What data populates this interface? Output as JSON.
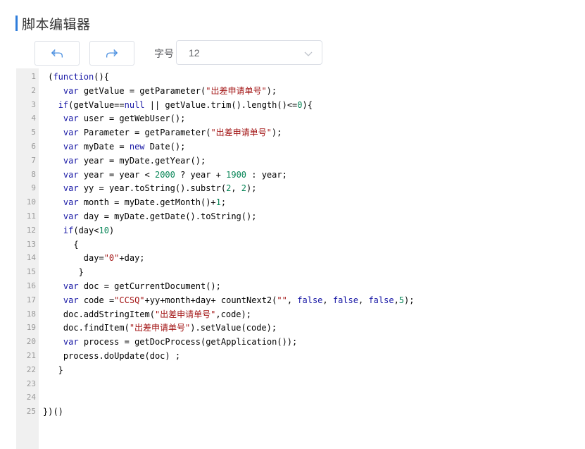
{
  "header": {
    "title": "脚本编辑器"
  },
  "toolbar": {
    "undo_icon": "undo-arrow-icon",
    "redo_icon": "redo-arrow-icon",
    "font_size_label": "字号",
    "font_size_value": "12"
  },
  "colors": {
    "accent": "#2f7ddb",
    "keyword": "#1a1aa6",
    "string": "#a31515"
  },
  "editor": {
    "lines": [
      {
        "n": "1",
        "text": " (function(){"
      },
      {
        "n": "2",
        "text": "    var getValue = getParameter(\"出差申请单号\");"
      },
      {
        "n": "3",
        "text": "   if(getValue==null || getValue.trim().length()<=0){"
      },
      {
        "n": "4",
        "text": "    var user = getWebUser();"
      },
      {
        "n": "5",
        "text": "    var Parameter = getParameter(\"出差申请单号\");"
      },
      {
        "n": "6",
        "text": "    var myDate = new Date();"
      },
      {
        "n": "7",
        "text": "    var year = myDate.getYear();"
      },
      {
        "n": "8",
        "text": "    var year = year < 2000 ? year + 1900 : year;"
      },
      {
        "n": "9",
        "text": "    var yy = year.toString().substr(2, 2);"
      },
      {
        "n": "10",
        "text": "    var month = myDate.getMonth()+1;"
      },
      {
        "n": "11",
        "text": "    var day = myDate.getDate().toString();"
      },
      {
        "n": "12",
        "text": "    if(day<10)"
      },
      {
        "n": "13",
        "text": "      {"
      },
      {
        "n": "14",
        "text": "        day=\"0\"+day;"
      },
      {
        "n": "15",
        "text": "       }"
      },
      {
        "n": "16",
        "text": "    var doc = getCurrentDocument();"
      },
      {
        "n": "17",
        "text": "    var code =\"CCSQ\"+yy+month+day+ countNext2(\"\", false, false, false,5);"
      },
      {
        "n": "18",
        "text": "    doc.addStringItem(\"出差申请单号\",code);"
      },
      {
        "n": "19",
        "text": "    doc.findItem(\"出差申请单号\").setValue(code);"
      },
      {
        "n": "20",
        "text": "    var process = getDocProcess(getApplication());"
      },
      {
        "n": "21",
        "text": "    process.doUpdate(doc) ;"
      },
      {
        "n": "22",
        "text": "   }"
      },
      {
        "n": "23",
        "text": ""
      },
      {
        "n": "24",
        "text": ""
      },
      {
        "n": "25",
        "text": "})()"
      }
    ]
  }
}
